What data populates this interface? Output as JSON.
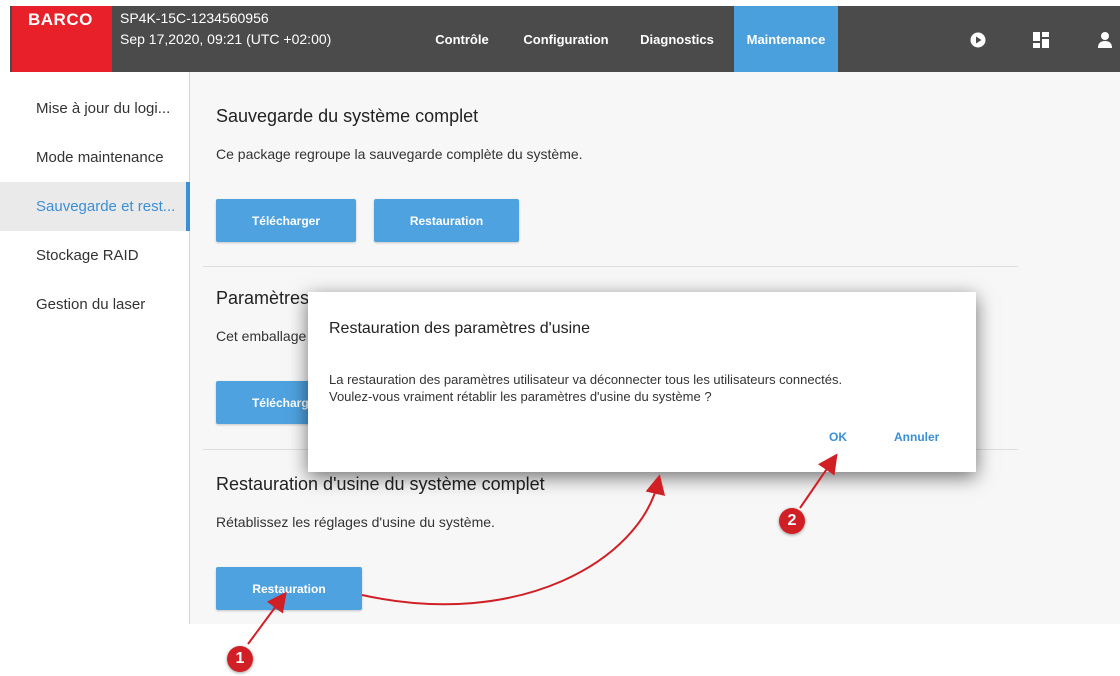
{
  "header": {
    "brand": "BARCO",
    "device_name": "SP4K-15C-1234560956",
    "datetime": "Sep 17,2020, 09:21 (UTC +02:00)",
    "nav": [
      "Contrôle",
      "Configuration",
      "Diagnostics",
      "Maintenance"
    ],
    "active_nav": "Maintenance",
    "icons": [
      "play-icon",
      "dashboard-icon",
      "user-icon"
    ],
    "brand_color": "#e8202a",
    "accent_color": "#4a9fdd"
  },
  "sidebar": {
    "items": [
      "Mise à jour du logi...",
      "Mode maintenance",
      "Sauvegarde et rest...",
      "Stockage RAID",
      "Gestion du laser"
    ],
    "active_index": 2
  },
  "sections": {
    "full_backup": {
      "title": "Sauvegarde du système complet",
      "description": "Ce package regroupe la sauvegarde complète du système.",
      "download_label": "Télécharger",
      "restore_label": "Restauration"
    },
    "params": {
      "title": "Paramètres",
      "description": "Cet emballage",
      "download_label": "Télécharger"
    },
    "factory": {
      "title": "Restauration d'usine du système complet",
      "description": "Rétablissez les réglages d'usine du système.",
      "restore_label": "Restauration"
    }
  },
  "dialog": {
    "title": "Restauration des paramètres d'usine",
    "line1": "La restauration des paramètres utilisateur va déconnecter tous les utilisateurs connectés.",
    "line2": "Voulez-vous vraiment rétablir les paramètres d'usine du système ?",
    "ok_label": "OK",
    "cancel_label": "Annuler"
  },
  "annotations": {
    "callout_1": "1",
    "callout_2": "2",
    "color": "#d11f26"
  }
}
